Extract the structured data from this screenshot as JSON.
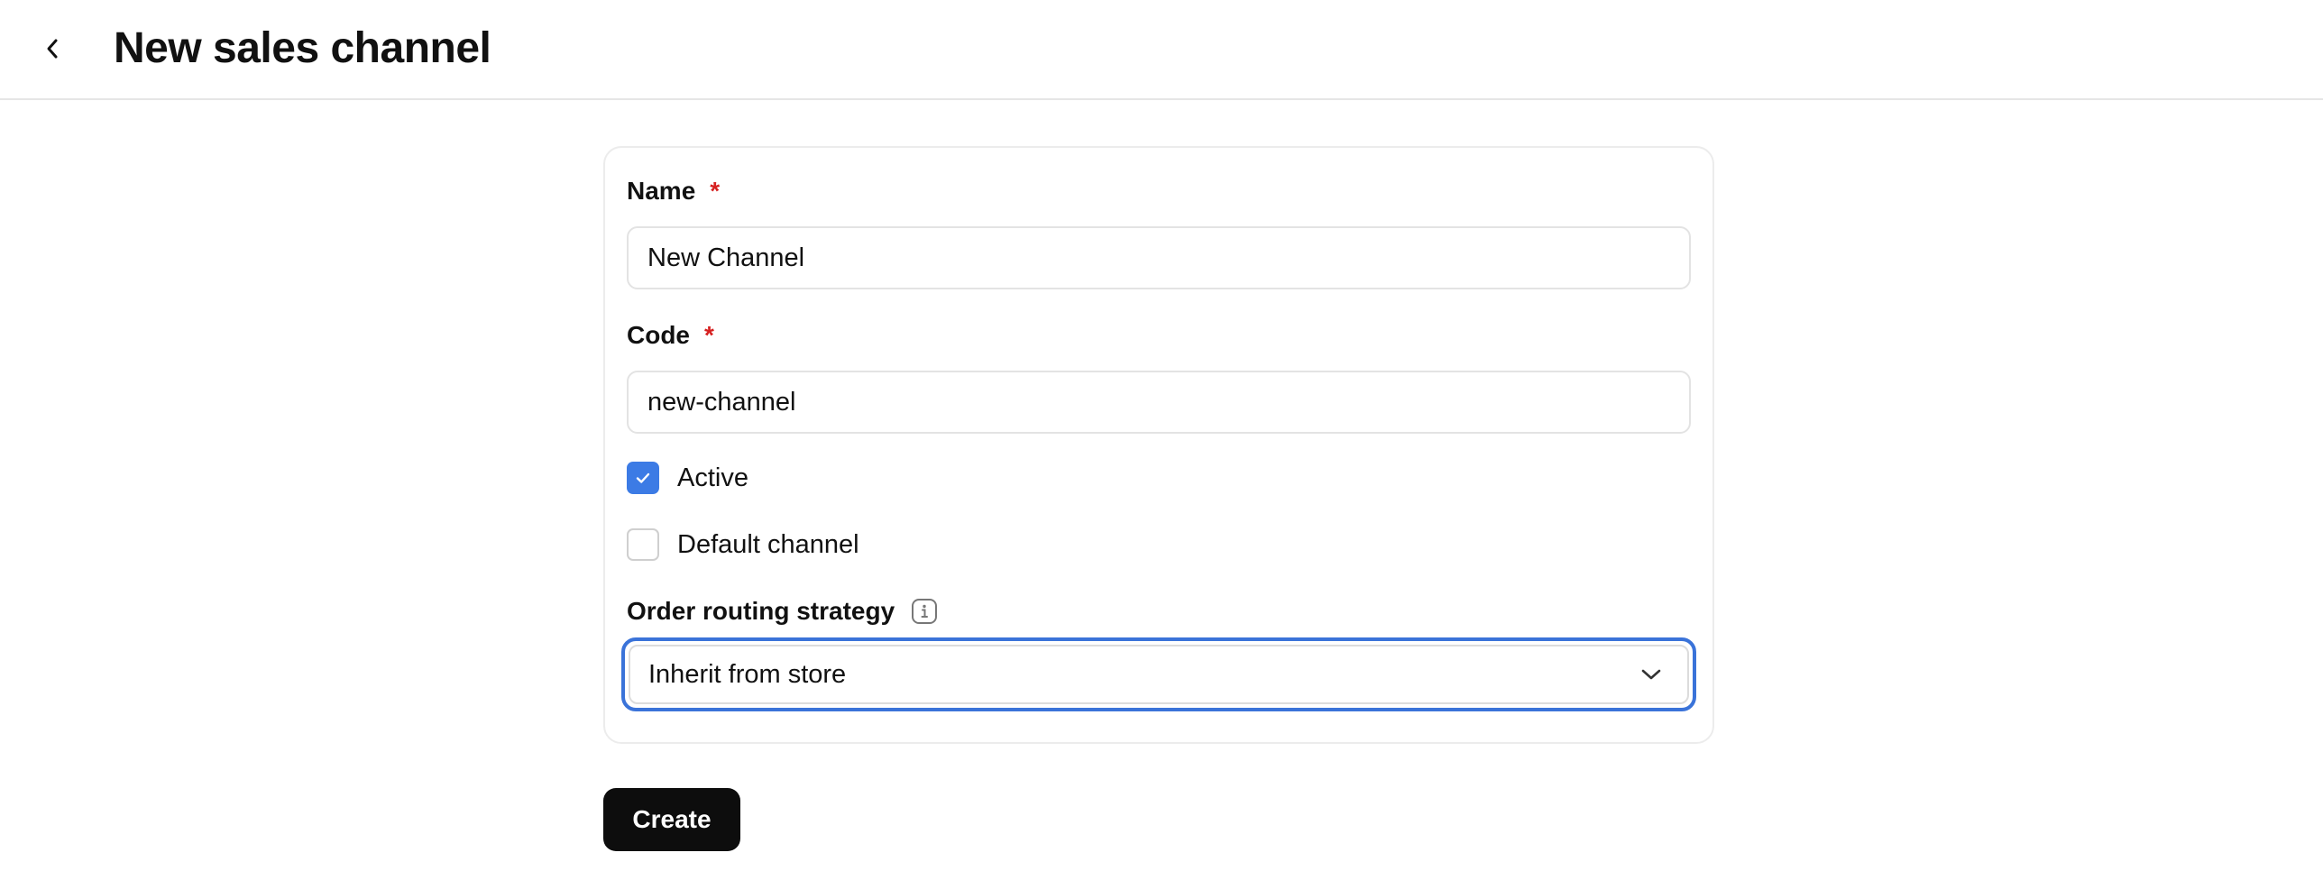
{
  "header": {
    "title": "New sales channel",
    "back_icon": "chevron-left-icon"
  },
  "form": {
    "name": {
      "label": "Name",
      "required_mark": "*",
      "value": "New Channel"
    },
    "code": {
      "label": "Code",
      "required_mark": "*",
      "value": "new-channel"
    },
    "active": {
      "label": "Active",
      "checked": true
    },
    "default_channel": {
      "label": "Default channel",
      "checked": false
    },
    "routing": {
      "label": "Order routing strategy",
      "info_icon": "info-icon",
      "selected": "Inherit from store",
      "chevron_icon": "chevron-down-icon"
    }
  },
  "actions": {
    "create_label": "Create"
  },
  "colors": {
    "accent": "#3c7be5",
    "focus_ring": "#3a73d9",
    "required": "#d62020",
    "primary_button": "#0d0d0d"
  }
}
